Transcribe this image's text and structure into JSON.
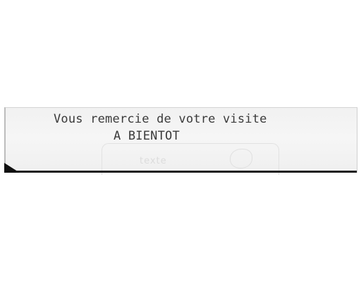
{
  "receipt": {
    "lines": [
      "Vous remercie de votre visite",
      "A BIENTOT"
    ],
    "faint_stamp_text": "texte"
  },
  "colors": {
    "paper": "#f3f3f3",
    "ink": "#3a3a3a",
    "edge": "#1f1f1f"
  }
}
